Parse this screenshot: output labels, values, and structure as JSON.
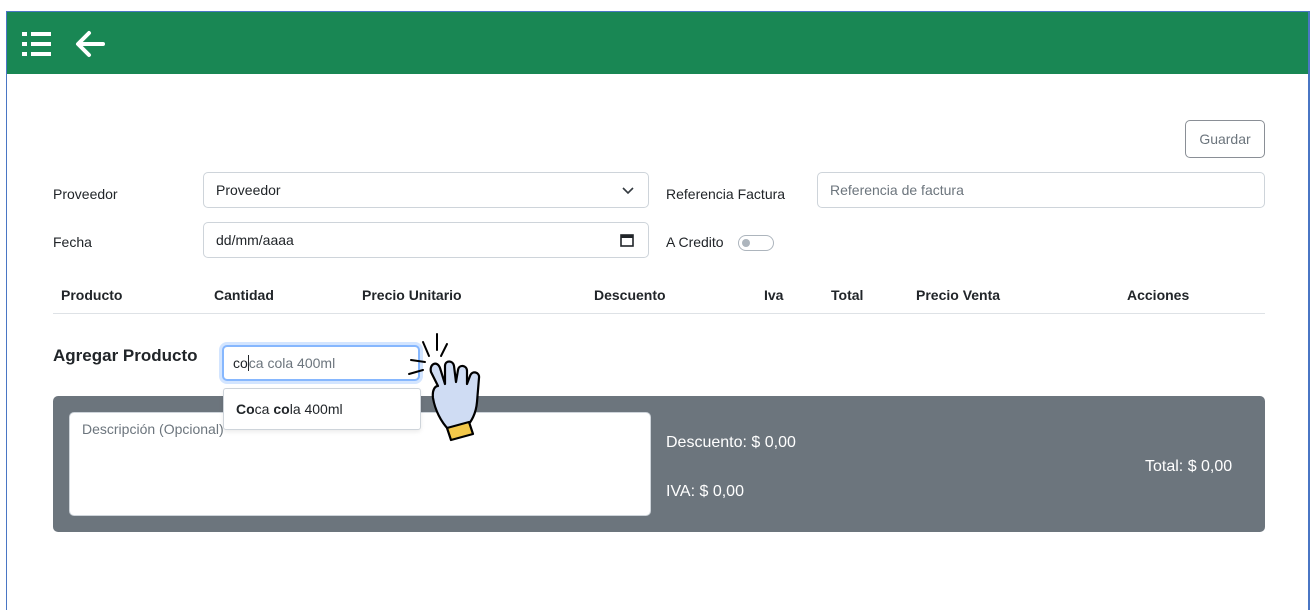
{
  "toolbar": {
    "menu_icon": "list-icon",
    "back_icon": "arrow-left-icon",
    "bar_color": "#198754"
  },
  "actions": {
    "save_label": "Guardar"
  },
  "form": {
    "proveedor_label": "Proveedor",
    "proveedor_value": "Proveedor",
    "referencia_label": "Referencia Factura",
    "referencia_placeholder": "Referencia de factura",
    "fecha_label": "Fecha",
    "fecha_value": "dd/mm/aaaa",
    "credito_label": "A Credito",
    "credito_on": false
  },
  "table": {
    "columns": [
      "Producto",
      "Cantidad",
      "Precio Unitario",
      "Descuento",
      "Iva",
      "Total",
      "Precio Venta",
      "Acciones"
    ]
  },
  "add_product": {
    "title": "Agregar Producto",
    "typed": "co",
    "suggestion_rest": "ca cola 400ml",
    "dropdown_match_1": "Co",
    "dropdown_plain_1": "ca ",
    "dropdown_match_2": "co",
    "dropdown_plain_2": "la 400ml"
  },
  "summary": {
    "description_placeholder": "Descripción (Opcional)",
    "descuento": "Descuento: $ 0,00",
    "iva": "IVA: $ 0,00",
    "total": "Total: $ 0,00",
    "panel_color": "#6c757d"
  },
  "cursor": {
    "icon": "pointer-hand-click-icon"
  }
}
